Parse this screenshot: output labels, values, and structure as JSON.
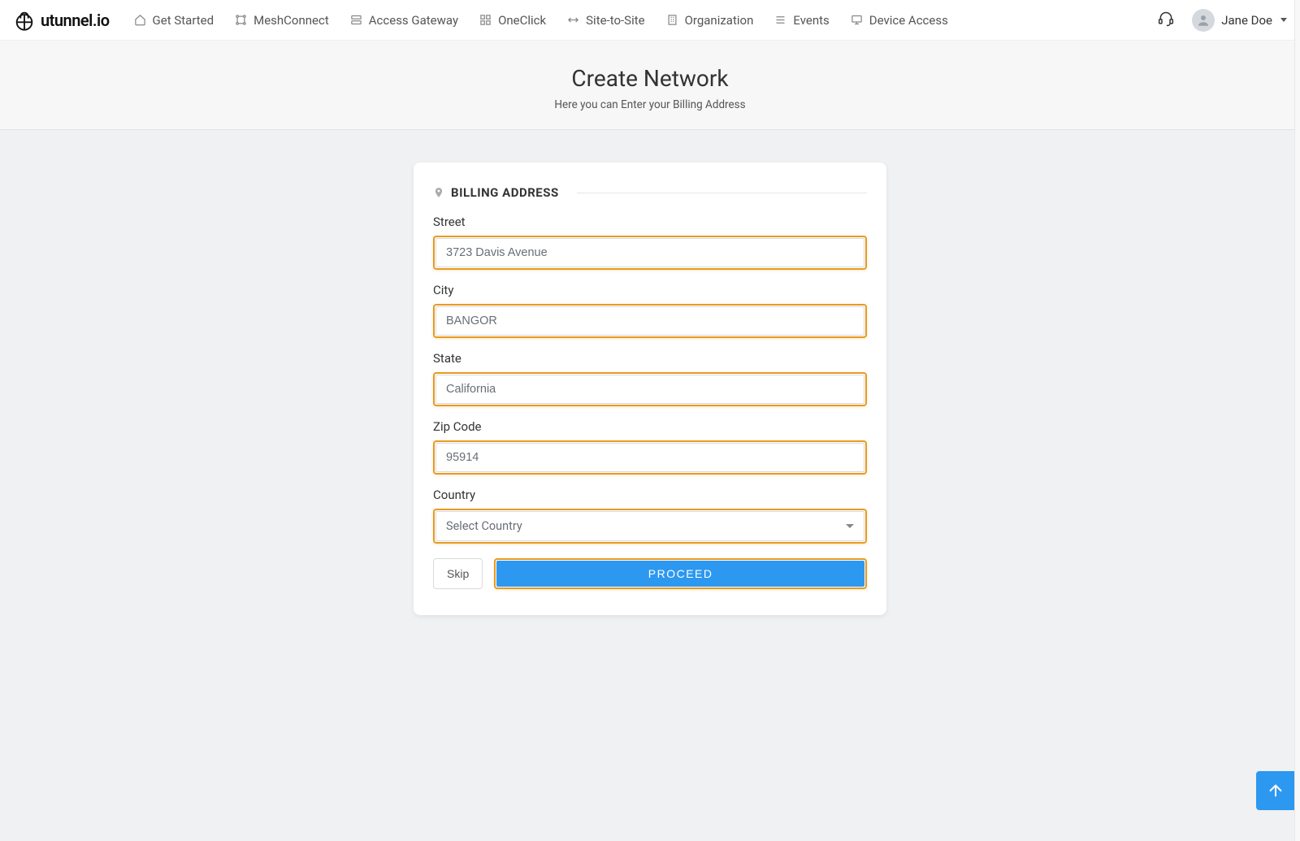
{
  "brand": "utunnel.io",
  "nav": {
    "items": [
      {
        "name": "get-started",
        "label": "Get Started"
      },
      {
        "name": "meshconnect",
        "label": "MeshConnect"
      },
      {
        "name": "access-gateway",
        "label": "Access Gateway"
      },
      {
        "name": "oneclick",
        "label": "OneClick"
      },
      {
        "name": "site-to-site",
        "label": "Site-to-Site"
      },
      {
        "name": "organization",
        "label": "Organization"
      },
      {
        "name": "events",
        "label": "Events"
      },
      {
        "name": "device-access",
        "label": "Device Access"
      }
    ]
  },
  "user": {
    "name": "Jane Doe"
  },
  "header": {
    "title": "Create Network",
    "subtitle": "Here you can Enter your Billing Address"
  },
  "section": {
    "title": "BILLING ADDRESS"
  },
  "form": {
    "street": {
      "label": "Street",
      "value": "3723 Davis Avenue"
    },
    "city": {
      "label": "City",
      "value": "BANGOR"
    },
    "state": {
      "label": "State",
      "value": "California"
    },
    "zip": {
      "label": "Zip Code",
      "value": "95914"
    },
    "country": {
      "label": "Country",
      "value": "Select Country"
    }
  },
  "actions": {
    "skip": "Skip",
    "proceed": "PROCEED"
  }
}
